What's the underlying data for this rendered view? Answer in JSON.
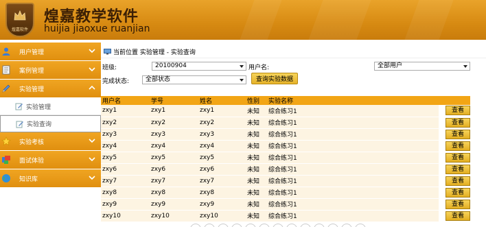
{
  "header": {
    "title": "煌嘉教学软件",
    "subtitle": "huijia jiaoxue ruanjian",
    "logo_badge": "煌嘉软件",
    "colors": {
      "primary": "#e9a32a",
      "dark": "#3b1f05"
    }
  },
  "sidebar": {
    "items": [
      {
        "label": "用户管理",
        "icon": "user-icon"
      },
      {
        "label": "案例管理",
        "icon": "document-icon"
      },
      {
        "label": "实验管理",
        "icon": "pencil-icon",
        "expanded": true
      },
      {
        "label": "实验考核",
        "icon": "star-icon"
      },
      {
        "label": "面试体验",
        "icon": "interview-icon"
      },
      {
        "label": "知识库",
        "icon": "globe-icon"
      }
    ],
    "subitems": [
      {
        "label": "实验管理",
        "icon": "edit-icon"
      },
      {
        "label": "实验查询",
        "icon": "edit-icon",
        "active": true
      }
    ]
  },
  "breadcrumb": {
    "text": "当前位置 实验管理 - 实验查询"
  },
  "filters": {
    "class_label": "班级:",
    "class_value": "20100904",
    "user_label": "用户名:",
    "user_value": "全部用户",
    "status_label": "完成状态:",
    "status_value": "全部状态",
    "query_button": "查询实验数据"
  },
  "table": {
    "headers": [
      "用户名",
      "学号",
      "姓名",
      "性别",
      "实验名称"
    ],
    "action_label": "查看",
    "rows": [
      [
        "zxy1",
        "zxy1",
        "zxy1",
        "未知",
        "综合练习1"
      ],
      [
        "zxy2",
        "zxy2",
        "zxy2",
        "未知",
        "综合练习1"
      ],
      [
        "zxy3",
        "zxy3",
        "zxy3",
        "未知",
        "综合练习1"
      ],
      [
        "zxy4",
        "zxy4",
        "zxy4",
        "未知",
        "综合练习1"
      ],
      [
        "zxy5",
        "zxy5",
        "zxy5",
        "未知",
        "综合练习1"
      ],
      [
        "zxy6",
        "zxy6",
        "zxy6",
        "未知",
        "综合练习1"
      ],
      [
        "zxy7",
        "zxy7",
        "zxy7",
        "未知",
        "综合练习1"
      ],
      [
        "zxy8",
        "zxy8",
        "zxy8",
        "未知",
        "综合练习1"
      ],
      [
        "zxy9",
        "zxy9",
        "zxy9",
        "未知",
        "综合练习1"
      ],
      [
        "zxy10",
        "zxy10",
        "zxy10",
        "未知",
        "综合练习1"
      ]
    ]
  }
}
